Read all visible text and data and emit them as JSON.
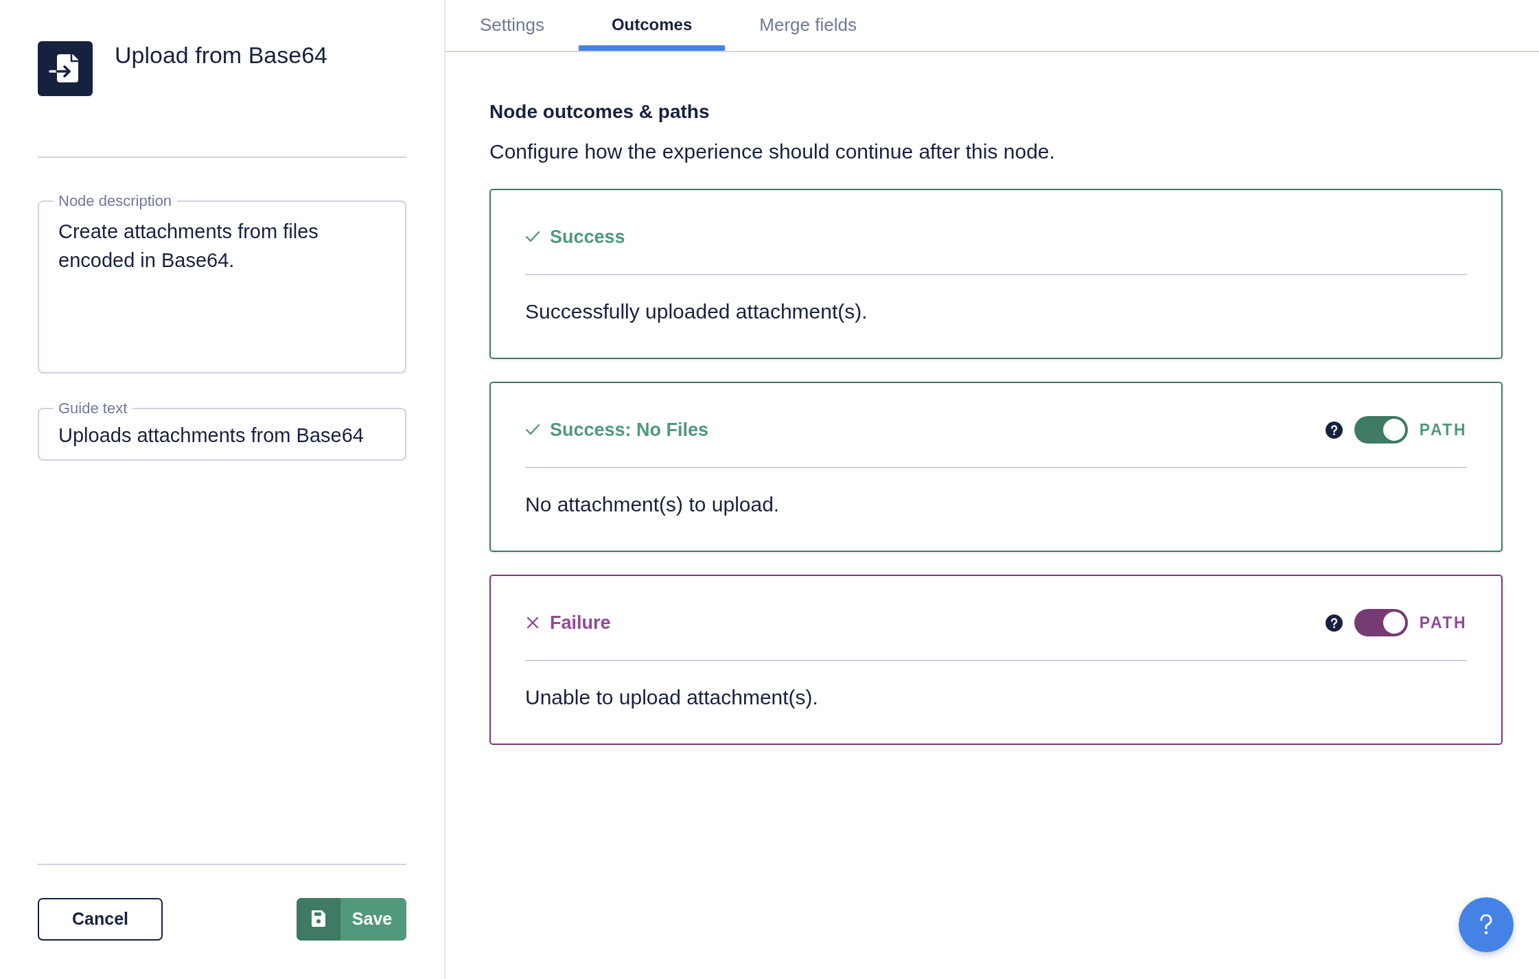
{
  "node": {
    "title": "Upload from Base64"
  },
  "fields": [
    {
      "label": "Node description",
      "value": "Create attachments from files encoded in Base64.",
      "kind": "multiline"
    },
    {
      "label": "Guide text",
      "value": "Uploads attachments from Base64",
      "kind": "single"
    }
  ],
  "actions": [
    {
      "label": "Cancel",
      "kind": "secondary"
    },
    {
      "label": "Save",
      "kind": "primary"
    }
  ],
  "tabs": [
    {
      "label": "Settings",
      "selected": false
    },
    {
      "label": "Outcomes",
      "selected": true
    },
    {
      "label": "Merge fields",
      "selected": false
    }
  ],
  "section": {
    "title": "Node outcomes & paths",
    "description": "Configure how the experience should continue after this node."
  },
  "outcomes": [
    {
      "kind": "success",
      "title": "Success",
      "description": "Successfully uploaded attachment(s)."
    },
    {
      "kind": "success",
      "title": "Success: No Files",
      "description": "No attachment(s) to upload.",
      "path": {
        "on": true,
        "label": "PATH"
      }
    },
    {
      "kind": "failure",
      "title": "Failure",
      "description": "Unable to upload attachment(s).",
      "path": {
        "on": true,
        "label": "PATH"
      }
    }
  ]
}
